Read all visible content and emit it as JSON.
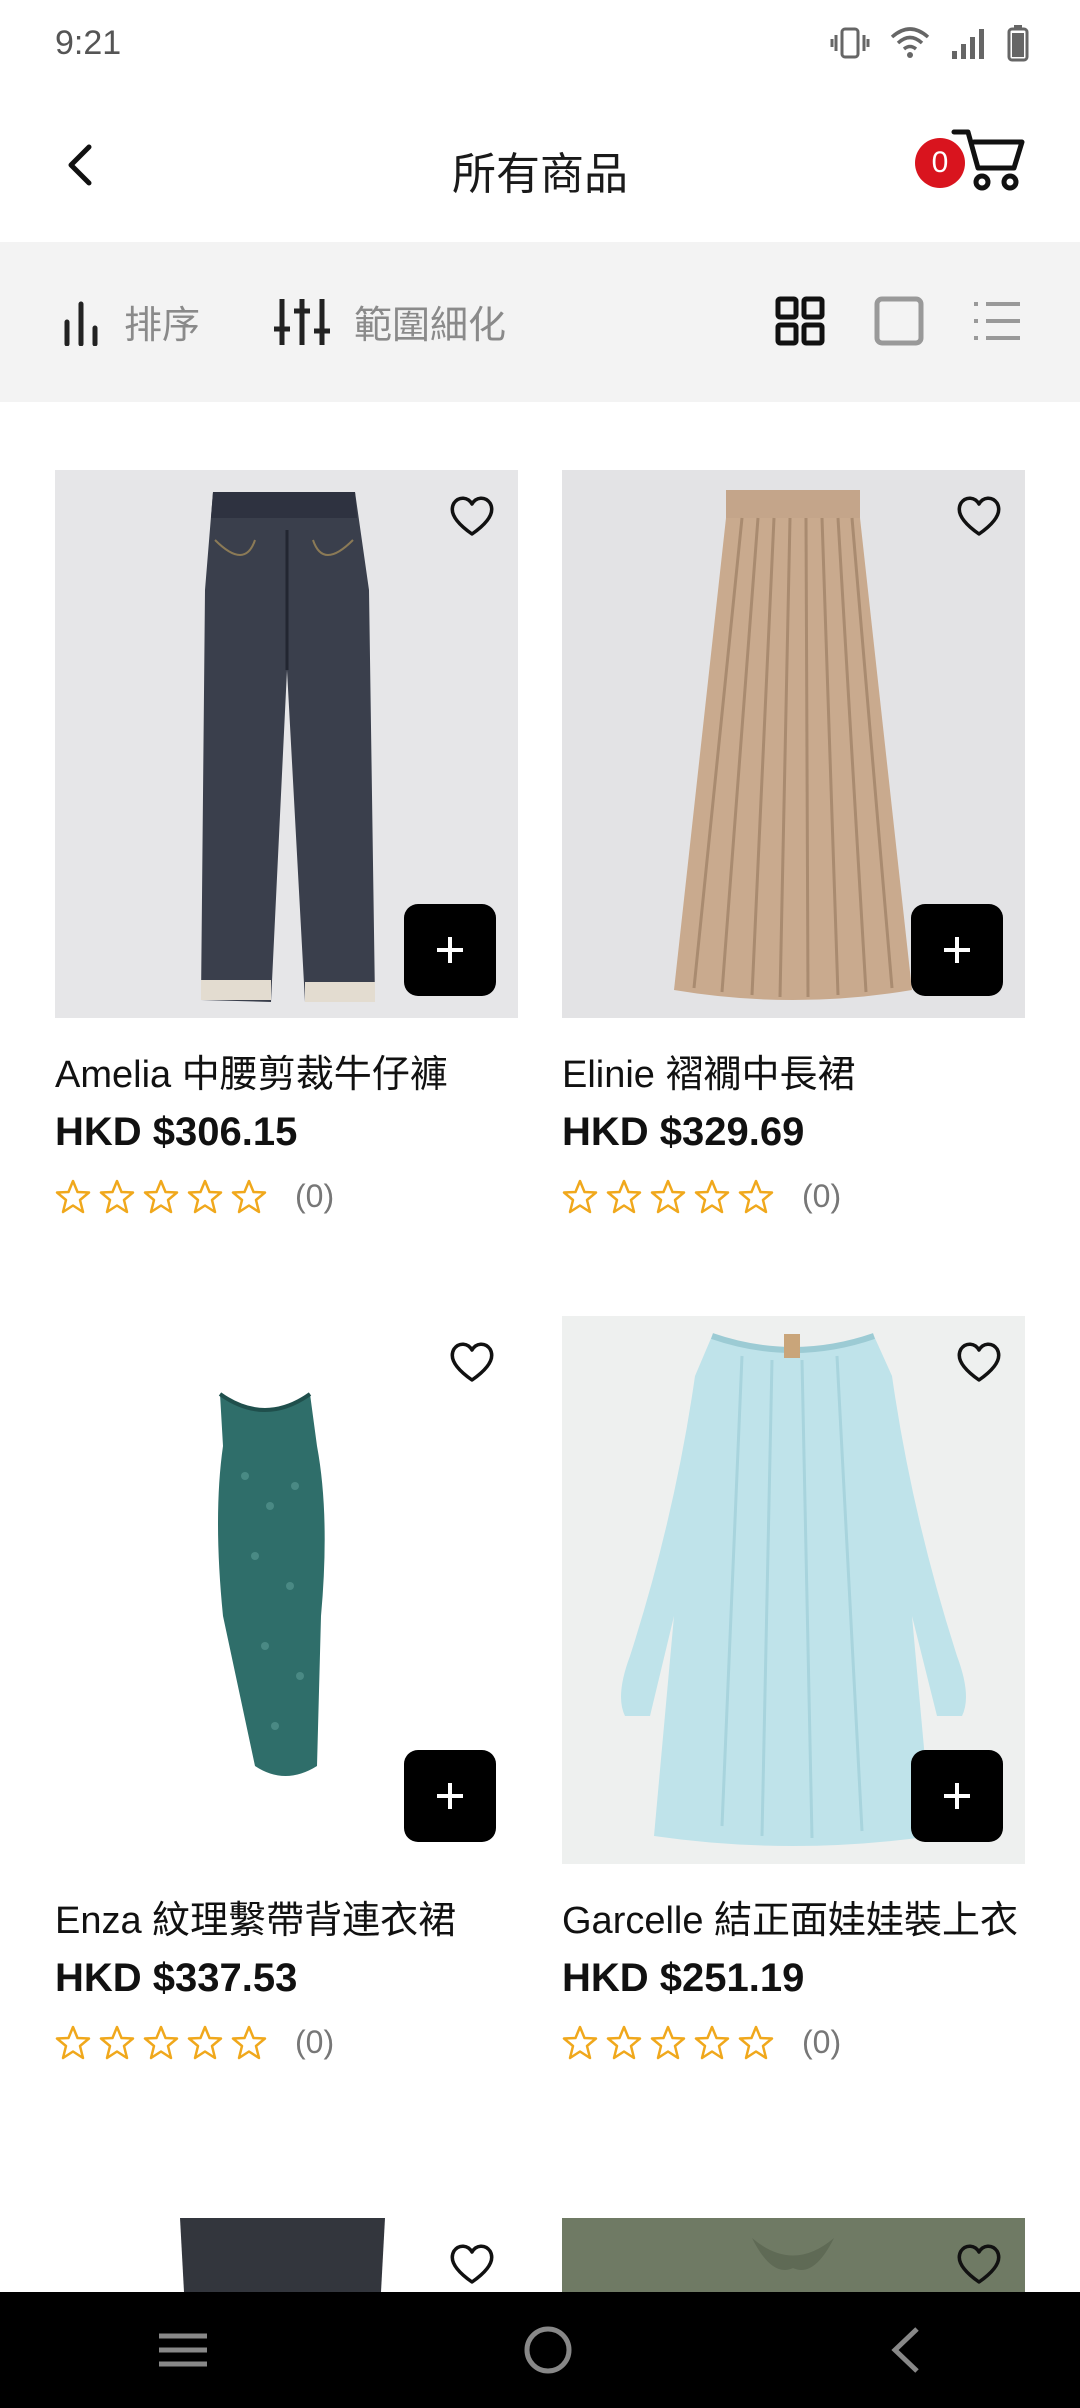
{
  "status": {
    "time": "9:21"
  },
  "header": {
    "title": "所有商品",
    "cart_count": "0"
  },
  "toolbar": {
    "sort_label": "排序",
    "filter_label": "範圍細化"
  },
  "products": [
    {
      "name": "Amelia 中腰剪裁牛仔褲",
      "price": "HKD $306.15",
      "rating_count": "(0)",
      "image": "dark-denim-jeans"
    },
    {
      "name": "Elinie 褶襉中長裙",
      "price": "HKD $329.69",
      "rating_count": "(0)",
      "image": "beige-pleated-skirt"
    },
    {
      "name": "Enza 紋理繫帶背連衣裙",
      "price": "HKD $337.53",
      "rating_count": "(0)",
      "image": "teal-textured-dress"
    },
    {
      "name": "Garcelle 結正面娃娃裝上衣",
      "price": "HKD $251.19",
      "rating_count": "(0)",
      "image": "light-blue-smock-top"
    }
  ],
  "colors": {
    "accent": "#d9141e",
    "star": "#f0a81c",
    "toolbar_bg": "#f3f3f3"
  }
}
